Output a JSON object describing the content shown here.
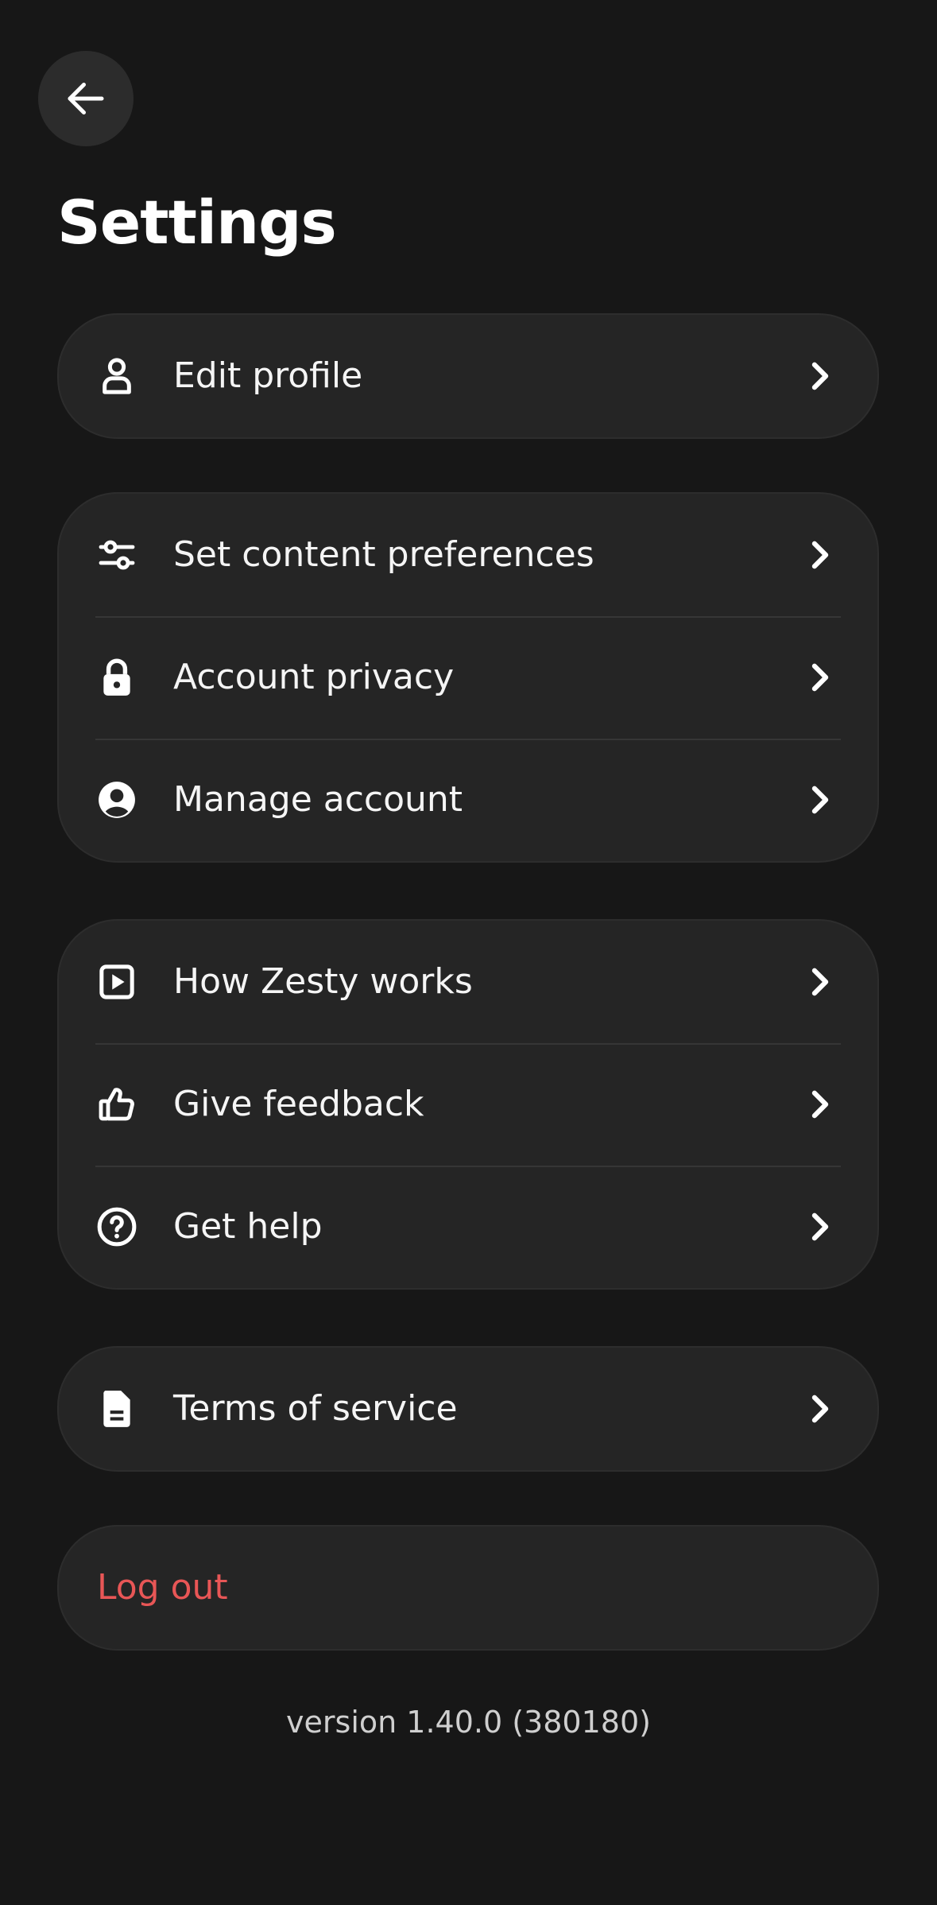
{
  "header": {
    "back_icon": "arrow-left-icon",
    "title": "Settings"
  },
  "groups": [
    {
      "items": [
        {
          "label": "Edit profile",
          "icon": "person-icon"
        }
      ]
    },
    {
      "items": [
        {
          "label": "Set content preferences",
          "icon": "sliders-icon"
        },
        {
          "label": "Account privacy",
          "icon": "lock-icon"
        },
        {
          "label": "Manage account",
          "icon": "user-circle-icon"
        }
      ]
    },
    {
      "items": [
        {
          "label": "How Zesty works",
          "icon": "play-square-icon"
        },
        {
          "label": "Give feedback",
          "icon": "thumbs-up-icon"
        },
        {
          "label": "Get help",
          "icon": "question-circle-icon"
        }
      ]
    },
    {
      "items": [
        {
          "label": "Terms of service",
          "icon": "document-icon"
        }
      ]
    }
  ],
  "logout": {
    "label": "Log out",
    "color": "#e85656"
  },
  "version": "version 1.40.0 (380180)",
  "colors": {
    "background": "#171717",
    "card": "#252525",
    "text": "#f5f5f5",
    "danger": "#e85656"
  }
}
